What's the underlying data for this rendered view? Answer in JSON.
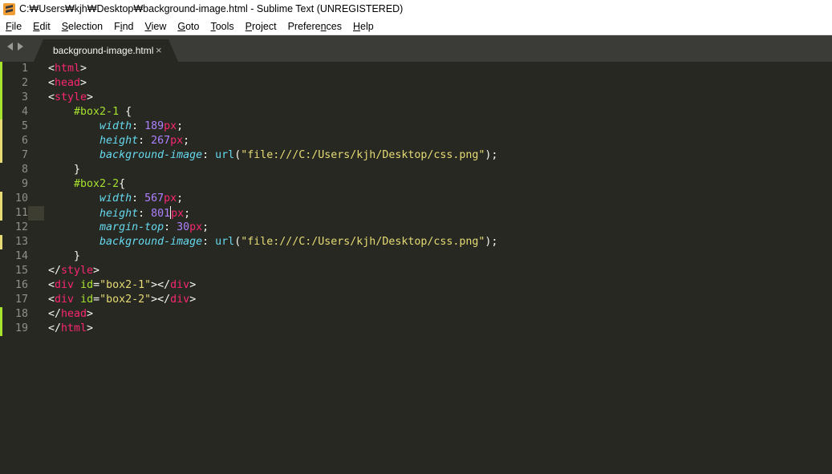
{
  "window": {
    "title": "C:₩Users₩kjh₩Desktop₩background-image.html - Sublime Text (UNREGISTERED)",
    "icon": "sublime-text-icon"
  },
  "menu": {
    "items": [
      {
        "label": "File",
        "accel": "F"
      },
      {
        "label": "Edit",
        "accel": "E"
      },
      {
        "label": "Selection",
        "accel": "S"
      },
      {
        "label": "Find",
        "accel": "i"
      },
      {
        "label": "View",
        "accel": "V"
      },
      {
        "label": "Goto",
        "accel": "G"
      },
      {
        "label": "Tools",
        "accel": "T"
      },
      {
        "label": "Project",
        "accel": "P"
      },
      {
        "label": "Preferences",
        "accel": "n"
      },
      {
        "label": "Help",
        "accel": "H"
      }
    ]
  },
  "tabs": [
    {
      "label": "background-image.html",
      "close": "×",
      "active": true
    }
  ],
  "editor": {
    "current_line": 11,
    "lines": [
      {
        "n": "1",
        "mark": "green",
        "tokens": [
          [
            "p",
            "<"
          ],
          [
            "t",
            "html"
          ],
          [
            "p",
            ">"
          ]
        ]
      },
      {
        "n": "2",
        "mark": "green",
        "tokens": [
          [
            "p",
            "<"
          ],
          [
            "t",
            "head"
          ],
          [
            "p",
            ">"
          ]
        ]
      },
      {
        "n": "3",
        "mark": "green",
        "tokens": [
          [
            "p",
            "<"
          ],
          [
            "t",
            "style"
          ],
          [
            "p",
            ">"
          ]
        ]
      },
      {
        "n": "4",
        "mark": "green",
        "tokens": [
          [
            "p",
            "    "
          ],
          [
            "a",
            "#box2-1"
          ],
          [
            "p",
            " {"
          ]
        ]
      },
      {
        "n": "5",
        "mark": "yellow",
        "tokens": [
          [
            "p",
            "        "
          ],
          [
            "prop",
            "width"
          ],
          [
            "p",
            ": "
          ],
          [
            "n",
            "189"
          ],
          [
            "u",
            "px"
          ],
          [
            "p",
            ";"
          ]
        ]
      },
      {
        "n": "6",
        "mark": "yellow",
        "tokens": [
          [
            "p",
            "        "
          ],
          [
            "prop",
            "height"
          ],
          [
            "p",
            ": "
          ],
          [
            "n",
            "267"
          ],
          [
            "u",
            "px"
          ],
          [
            "p",
            ";"
          ]
        ]
      },
      {
        "n": "7",
        "mark": "yellow",
        "tokens": [
          [
            "p",
            "        "
          ],
          [
            "prop",
            "background-image"
          ],
          [
            "p",
            ": "
          ],
          [
            "f",
            "url"
          ],
          [
            "p",
            "("
          ],
          [
            "s",
            "\"file:///C:/Users/kjh/Desktop/css.png\""
          ],
          [
            "p",
            ");"
          ]
        ]
      },
      {
        "n": "8",
        "mark": "",
        "tokens": [
          [
            "p",
            "    }"
          ]
        ]
      },
      {
        "n": "9",
        "mark": "",
        "tokens": [
          [
            "p",
            "    "
          ],
          [
            "a",
            "#box2-2"
          ],
          [
            "p",
            "{"
          ]
        ]
      },
      {
        "n": "10",
        "mark": "yellow",
        "tokens": [
          [
            "p",
            "        "
          ],
          [
            "prop",
            "width"
          ],
          [
            "p",
            ": "
          ],
          [
            "n",
            "567"
          ],
          [
            "u",
            "px"
          ],
          [
            "p",
            ";"
          ]
        ]
      },
      {
        "n": "11",
        "mark": "yellow",
        "tokens": [
          [
            "p",
            "        "
          ],
          [
            "prop",
            "height"
          ],
          [
            "p",
            ": "
          ],
          [
            "n",
            "801"
          ],
          [
            "cursor",
            ""
          ],
          [
            "u",
            "px"
          ],
          [
            "p",
            ";"
          ]
        ]
      },
      {
        "n": "12",
        "mark": "",
        "tokens": [
          [
            "p",
            "        "
          ],
          [
            "prop",
            "margin-top"
          ],
          [
            "p",
            ": "
          ],
          [
            "n",
            "30"
          ],
          [
            "u",
            "px"
          ],
          [
            "p",
            ";"
          ]
        ]
      },
      {
        "n": "13",
        "mark": "yellow",
        "tokens": [
          [
            "p",
            "        "
          ],
          [
            "prop",
            "background-image"
          ],
          [
            "p",
            ": "
          ],
          [
            "f",
            "url"
          ],
          [
            "p",
            "("
          ],
          [
            "s",
            "\"file:///C:/Users/kjh/Desktop/css.png\""
          ],
          [
            "p",
            ");"
          ]
        ]
      },
      {
        "n": "14",
        "mark": "",
        "tokens": [
          [
            "p",
            "    }"
          ]
        ]
      },
      {
        "n": "15",
        "mark": "",
        "tokens": [
          [
            "p",
            "</"
          ],
          [
            "t",
            "style"
          ],
          [
            "p",
            ">"
          ]
        ]
      },
      {
        "n": "16",
        "mark": "",
        "tokens": [
          [
            "p",
            "<"
          ],
          [
            "t",
            "div"
          ],
          [
            "p",
            " "
          ],
          [
            "a",
            "id"
          ],
          [
            "p",
            "="
          ],
          [
            "s",
            "\"box2-1\""
          ],
          [
            "p",
            "></"
          ],
          [
            "t",
            "div"
          ],
          [
            "p",
            ">"
          ]
        ]
      },
      {
        "n": "17",
        "mark": "",
        "tokens": [
          [
            "p",
            "<"
          ],
          [
            "t",
            "div"
          ],
          [
            "p",
            " "
          ],
          [
            "a",
            "id"
          ],
          [
            "p",
            "="
          ],
          [
            "s",
            "\"box2-2\""
          ],
          [
            "p",
            "></"
          ],
          [
            "t",
            "div"
          ],
          [
            "p",
            ">"
          ]
        ]
      },
      {
        "n": "18",
        "mark": "green",
        "tokens": [
          [
            "p",
            "</"
          ],
          [
            "t",
            "head"
          ],
          [
            "p",
            ">"
          ]
        ]
      },
      {
        "n": "19",
        "mark": "green",
        "tokens": [
          [
            "p",
            "</"
          ],
          [
            "t",
            "html"
          ],
          [
            "p",
            ">"
          ]
        ]
      }
    ]
  },
  "colors": {
    "background": "#272822",
    "tag": "#f92672",
    "attribute": "#a6e22e",
    "string": "#e6db74",
    "property": "#66d9ef",
    "number": "#ae81ff",
    "gutter_green": "#a6e22e",
    "gutter_yellow": "#e6db74"
  }
}
